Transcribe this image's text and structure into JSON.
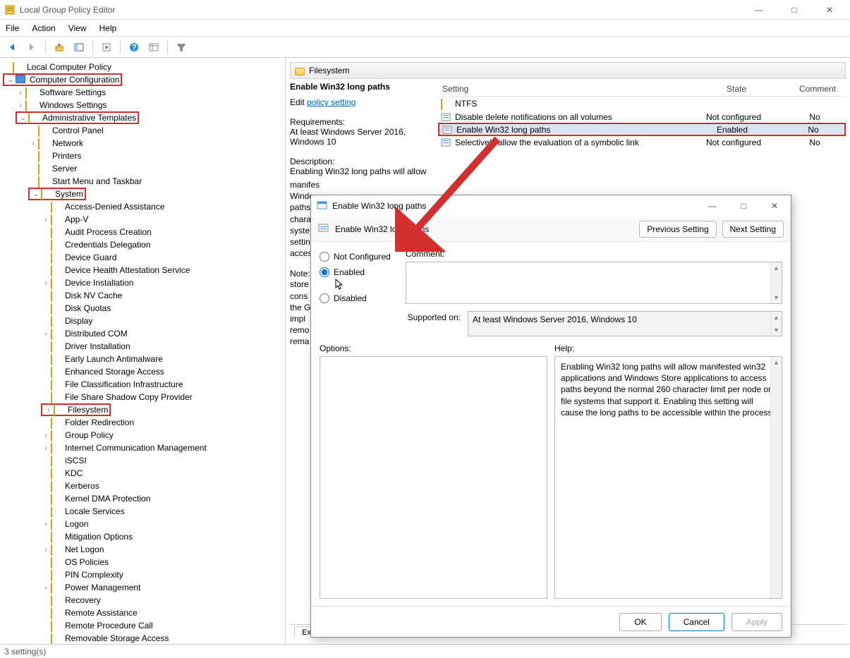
{
  "window": {
    "title": "Local Group Policy Editor"
  },
  "menubar": [
    "File",
    "Action",
    "View",
    "Help"
  ],
  "tree": {
    "root": "Local Computer Policy",
    "computer_config": "Computer Configuration",
    "software": "Software Settings",
    "windows": "Windows Settings",
    "admin": "Administrative Templates",
    "admin_children": [
      "Control Panel",
      "Network",
      "Printers",
      "Server",
      "Start Menu and Taskbar"
    ],
    "system": "System",
    "system_children": [
      "Access-Denied Assistance",
      "App-V",
      "Audit Process Creation",
      "Credentials Delegation",
      "Device Guard",
      "Device Health Attestation Service",
      "Device Installation",
      "Disk NV Cache",
      "Disk Quotas",
      "Display",
      "Distributed COM",
      "Driver Installation",
      "Early Launch Antimalware",
      "Enhanced Storage Access",
      "File Classification Infrastructure",
      "File Share Shadow Copy Provider",
      "Filesystem",
      "Folder Redirection",
      "Group Policy",
      "Internet Communication Management",
      "iSCSI",
      "KDC",
      "Kerberos",
      "Kernel DMA Protection",
      "Locale Services",
      "Logon",
      "Mitigation Options",
      "Net Logon",
      "OS Policies",
      "PIN Complexity",
      "Power Management",
      "Recovery",
      "Remote Assistance",
      "Remote Procedure Call",
      "Removable Storage Access"
    ],
    "filesystem_index": 16
  },
  "crumb": "Filesystem",
  "detail": {
    "title": "Enable Win32 long paths",
    "edit_prefix": "Edit ",
    "edit_link": "policy setting",
    "req_label": "Requirements:",
    "req_text": "At least Windows Server 2016, Windows 10",
    "desc_label": "Description:",
    "desc_text": "Enabling Win32 long paths will allow",
    "note_label": "Note:",
    "note_prefix": "store cons the G impl remo rema"
  },
  "list": {
    "cols": {
      "setting": "Setting",
      "state": "State",
      "comment": "Comment"
    },
    "rows": [
      {
        "icon": "folder",
        "name": "NTFS",
        "state": "",
        "comment": ""
      },
      {
        "icon": "policy",
        "name": "Disable delete notifications on all volumes",
        "state": "Not configured",
        "comment": "No"
      },
      {
        "icon": "policy",
        "name": "Enable Win32 long paths",
        "state": "Enabled",
        "comment": "No",
        "selected": true,
        "highlighted": true
      },
      {
        "icon": "policy",
        "name": "Selectively allow the evaluation of a symbolic link",
        "state": "Not configured",
        "comment": "No"
      }
    ]
  },
  "tabs_bottom": "Exte",
  "statusbar": "3 setting(s)",
  "dialog": {
    "title": "Enable Win32 long paths",
    "header_name": "Enable Win32 long paths",
    "prev": "Previous Setting",
    "next": "Next Setting",
    "radios": {
      "nc": "Not Configured",
      "en": "Enabled",
      "di": "Disabled",
      "selected": "en"
    },
    "comment_label": "Comment:",
    "supported_label": "Supported on:",
    "supported_text": "At least Windows Server 2016, Windows 10",
    "options_label": "Options:",
    "help_label": "Help:",
    "help_text": "Enabling Win32 long paths will allow manifested win32 applications and Windows Store applications to access paths beyond the normal 260 character limit per node on file systems that support it.  Enabling this setting will cause the long paths to be accessible within the process.",
    "ok": "OK",
    "cancel": "Cancel",
    "apply": "Apply"
  }
}
